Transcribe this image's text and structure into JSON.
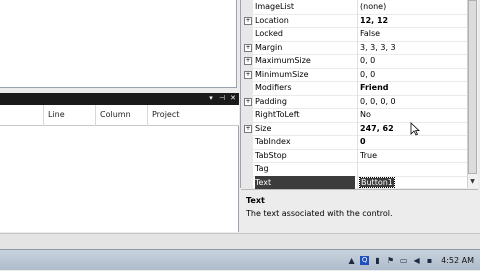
{
  "properties": [
    {
      "name": "ImageList",
      "value": "(none)",
      "expand": false,
      "bold": false
    },
    {
      "name": "Location",
      "value": "12, 12",
      "expand": true,
      "bold": true
    },
    {
      "name": "Locked",
      "value": "False",
      "expand": false,
      "bold": false
    },
    {
      "name": "Margin",
      "value": "3, 3, 3, 3",
      "expand": true,
      "bold": false
    },
    {
      "name": "MaximumSize",
      "value": "0, 0",
      "expand": true,
      "bold": false
    },
    {
      "name": "MinimumSize",
      "value": "0, 0",
      "expand": true,
      "bold": false
    },
    {
      "name": "Modifiers",
      "value": "Friend",
      "expand": false,
      "bold": true
    },
    {
      "name": "Padding",
      "value": "0, 0, 0, 0",
      "expand": true,
      "bold": false
    },
    {
      "name": "RightToLeft",
      "value": "No",
      "expand": false,
      "bold": false
    },
    {
      "name": "Size",
      "value": "247, 62",
      "expand": true,
      "bold": true
    },
    {
      "name": "TabIndex",
      "value": "0",
      "expand": false,
      "bold": true
    },
    {
      "name": "TabStop",
      "value": "True",
      "expand": false,
      "bold": false
    },
    {
      "name": "Tag",
      "value": "",
      "expand": false,
      "bold": false
    },
    {
      "name": "Text",
      "value": "Button1",
      "expand": false,
      "bold": false,
      "selected": true
    }
  ],
  "description": {
    "title": "Text",
    "text": "The text associated with the control."
  },
  "error_list": {
    "columns": [
      "Line",
      "Column",
      "Project"
    ],
    "buttons": [
      "▾",
      "⊣",
      "✕"
    ]
  },
  "taskbar": {
    "clock": "4:52 AM"
  }
}
